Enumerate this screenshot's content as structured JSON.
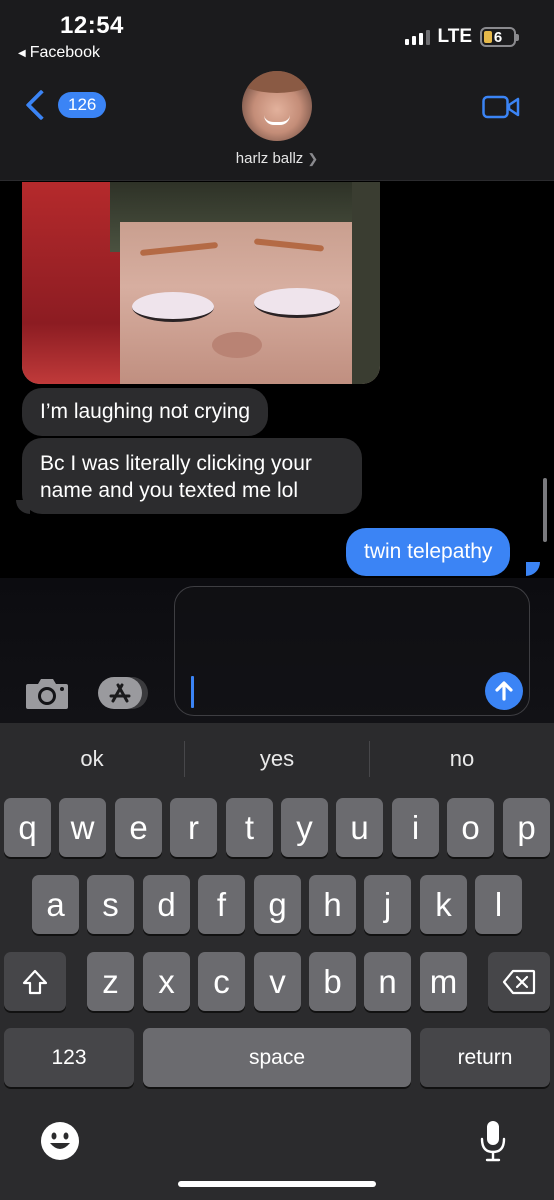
{
  "status_bar": {
    "time": "12:54",
    "back_app": "Facebook",
    "network": "LTE",
    "battery": "6",
    "icons": [
      "signal-icon",
      "battery-icon"
    ]
  },
  "header": {
    "back_count": "126",
    "contact_name": "harlz ballz",
    "icons": [
      "chevron-left-icon",
      "video-camera-icon",
      "chevron-right-icon"
    ]
  },
  "messages": [
    {
      "direction": "incoming",
      "type": "photo"
    },
    {
      "direction": "incoming",
      "text": "I’m laughing not crying"
    },
    {
      "direction": "incoming",
      "text": "Bc I was literally clicking your name and you texted me lol",
      "lines": [
        "Bc I was literally clicking your",
        "name and you texted me lol"
      ]
    },
    {
      "direction": "outgoing",
      "text": "twin telepathy"
    }
  ],
  "composer": {
    "text": "",
    "icons": [
      "camera-icon",
      "app-store-icon",
      "send-arrow-icon"
    ],
    "accent_color": "#3b84f5"
  },
  "keyboard": {
    "predictions": [
      "ok",
      "yes",
      "no"
    ],
    "row1": [
      "q",
      "w",
      "e",
      "r",
      "t",
      "y",
      "u",
      "i",
      "o",
      "p"
    ],
    "row2": [
      "a",
      "s",
      "d",
      "f",
      "g",
      "h",
      "j",
      "k",
      "l"
    ],
    "row3": [
      "z",
      "x",
      "c",
      "v",
      "b",
      "n",
      "m"
    ],
    "numbers_key": "123",
    "space_key": "space",
    "return_key": "return",
    "icons": [
      "shift-icon",
      "backspace-icon",
      "emoji-icon",
      "microphone-icon"
    ]
  }
}
